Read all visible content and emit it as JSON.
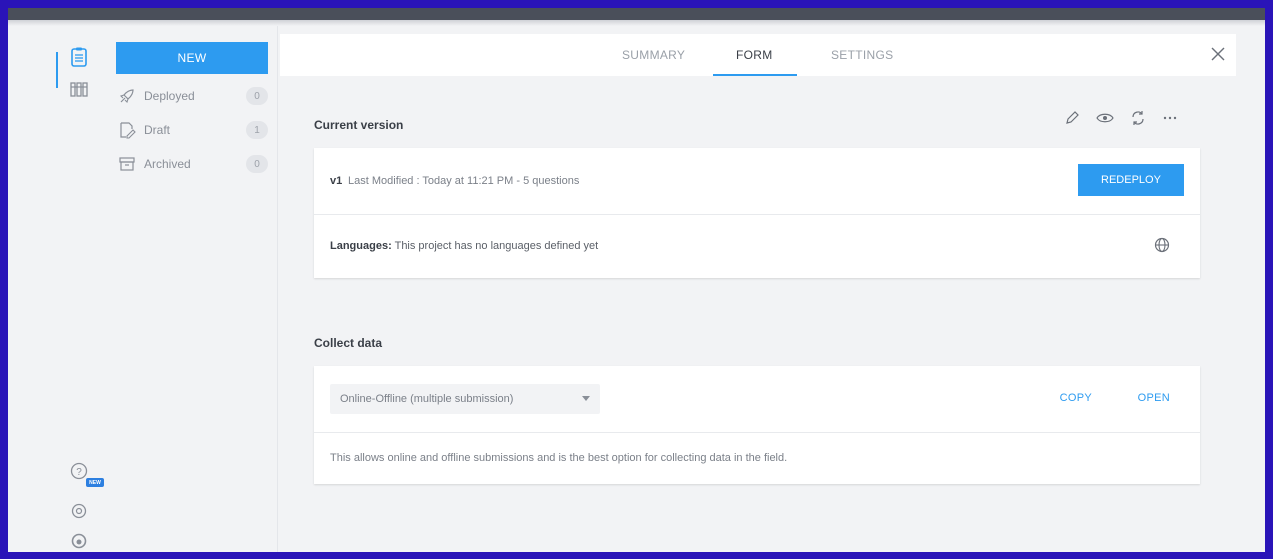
{
  "rail": {
    "badge_new": "NEW"
  },
  "sidebar": {
    "new_button": "NEW",
    "items": [
      {
        "label": "Deployed",
        "count": "0"
      },
      {
        "label": "Draft",
        "count": "1"
      },
      {
        "label": "Archived",
        "count": "0"
      }
    ]
  },
  "tabs": [
    {
      "label": "SUMMARY",
      "active": false
    },
    {
      "label": "FORM",
      "active": true
    },
    {
      "label": "SETTINGS",
      "active": false
    }
  ],
  "current_version": {
    "title": "Current version",
    "version": "v1",
    "modified": "Last Modified : Today at 11:21 PM - 5 questions",
    "redeploy_label": "REDEPLOY",
    "languages_label": "Languages:",
    "languages_text": "This project has no languages defined yet"
  },
  "collect_data": {
    "title": "Collect data",
    "selected_option": "Online-Offline (multiple submission)",
    "copy_label": "COPY",
    "open_label": "OPEN",
    "description": "This allows online and offline submissions and is the best option for collecting data in the field."
  },
  "colors": {
    "accent": "#2d9bf0",
    "frame_border": "#2a14b8"
  },
  "icons": [
    "forms-icon",
    "library-icon",
    "help-icon",
    "support-icon",
    "github-icon",
    "rocket-icon",
    "draft-icon",
    "archive-icon",
    "edit-icon",
    "preview-icon",
    "refresh-icon",
    "more-icon",
    "globe-icon",
    "close-icon"
  ]
}
